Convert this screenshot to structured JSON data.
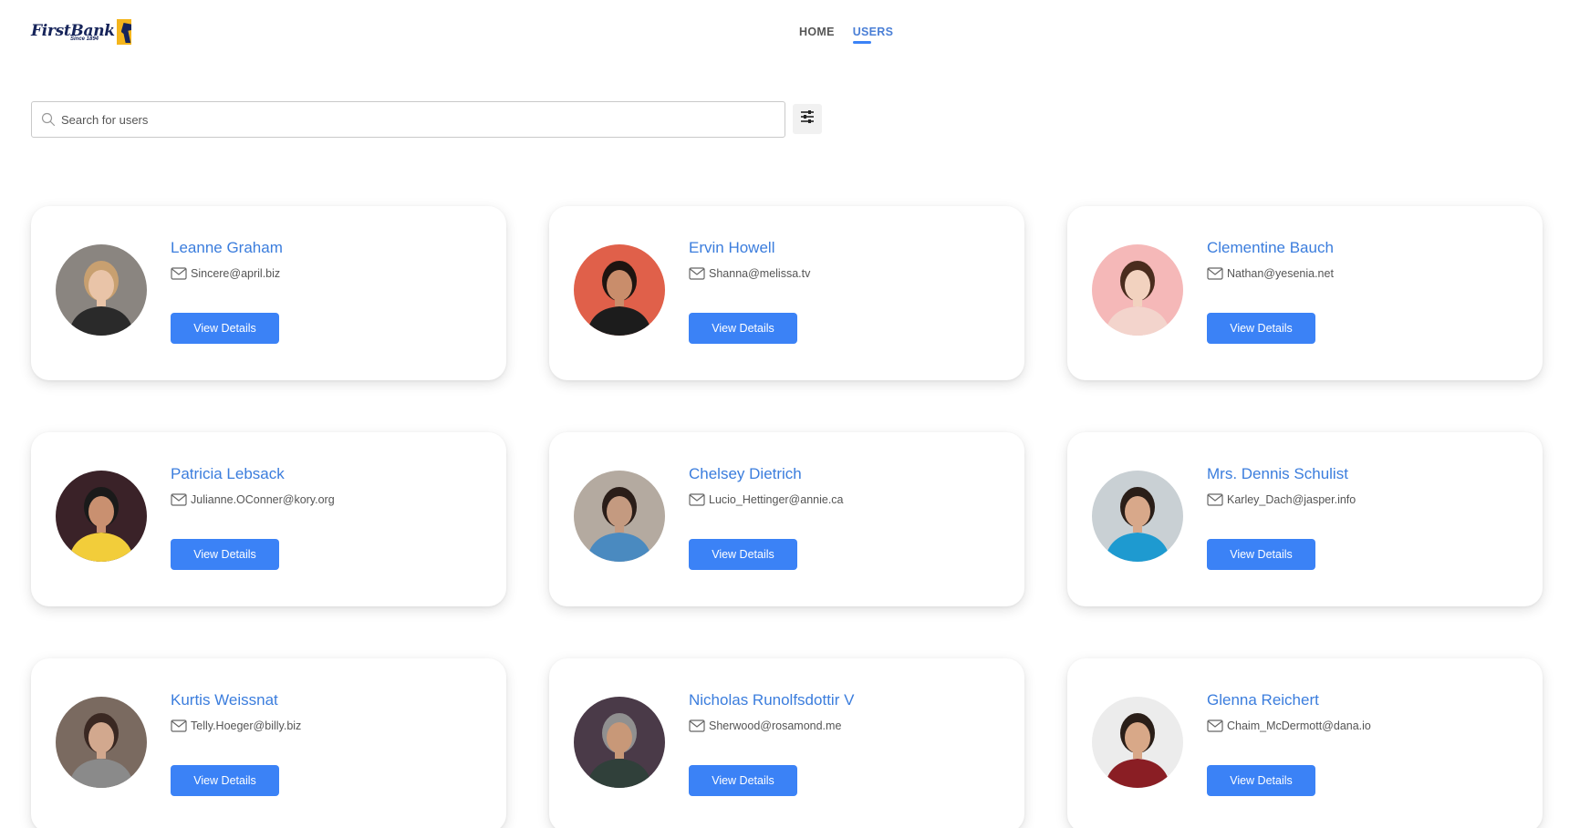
{
  "brand": {
    "name": "FirstBank",
    "tagline": "Since 1894",
    "colors": {
      "navy": "#16245a",
      "gold": "#f4b51c"
    }
  },
  "nav": {
    "items": [
      {
        "label": "HOME",
        "active": false
      },
      {
        "label": "USERS",
        "active": true
      }
    ]
  },
  "search": {
    "placeholder": "Search for users",
    "value": ""
  },
  "filter": {
    "icon": "sliders-icon"
  },
  "accent_color": "#3b82f6",
  "users": [
    {
      "name": "Leanne Graham",
      "email": "Sincere@april.biz",
      "button": "View Details",
      "avatar": {
        "bg": "#8a8580",
        "skin": "#e9c4a8",
        "hair": "#c8a070",
        "shirt": "#2a2a2a"
      }
    },
    {
      "name": "Ervin Howell",
      "email": "Shanna@melissa.tv",
      "button": "View Details",
      "avatar": {
        "bg": "#e0604a",
        "skin": "#c98d6b",
        "hair": "#1e1410",
        "shirt": "#1c1c1c"
      }
    },
    {
      "name": "Clementine Bauch",
      "email": "Nathan@yesenia.net",
      "button": "View Details",
      "avatar": {
        "bg": "#f5b8b8",
        "skin": "#f2d2bf",
        "hair": "#4a2c1e",
        "shirt": "#f3d4cc"
      }
    },
    {
      "name": "Patricia Lebsack",
      "email": "Julianne.OConner@kory.org",
      "button": "View Details",
      "avatar": {
        "bg": "#3a2228",
        "skin": "#c99070",
        "hair": "#1a1a1a",
        "shirt": "#f2cd3a"
      }
    },
    {
      "name": "Chelsey Dietrich",
      "email": "Lucio_Hettinger@annie.ca",
      "button": "View Details",
      "avatar": {
        "bg": "#b4aaa0",
        "skin": "#c49a80",
        "hair": "#2a1d18",
        "shirt": "#4a8ac0"
      }
    },
    {
      "name": "Mrs. Dennis Schulist",
      "email": "Karley_Dach@jasper.info",
      "button": "View Details",
      "avatar": {
        "bg": "#c9d0d4",
        "skin": "#d8a88a",
        "hair": "#2a1e18",
        "shirt": "#1e9ad0"
      }
    },
    {
      "name": "Kurtis Weissnat",
      "email": "Telly.Hoeger@billy.biz",
      "button": "View Details",
      "avatar": {
        "bg": "#7a6a60",
        "skin": "#d2a88e",
        "hair": "#3a2822",
        "shirt": "#8a8a8a"
      }
    },
    {
      "name": "Nicholas Runolfsdottir V",
      "email": "Sherwood@rosamond.me",
      "button": "View Details",
      "avatar": {
        "bg": "#4a3a48",
        "skin": "#c89878",
        "hair": "#909090",
        "shirt": "#30403a"
      }
    },
    {
      "name": "Glenna Reichert",
      "email": "Chaim_McDermott@dana.io",
      "button": "View Details",
      "avatar": {
        "bg": "#ececec",
        "skin": "#d8a888",
        "hair": "#2a1e18",
        "shirt": "#8a1e24"
      }
    }
  ]
}
